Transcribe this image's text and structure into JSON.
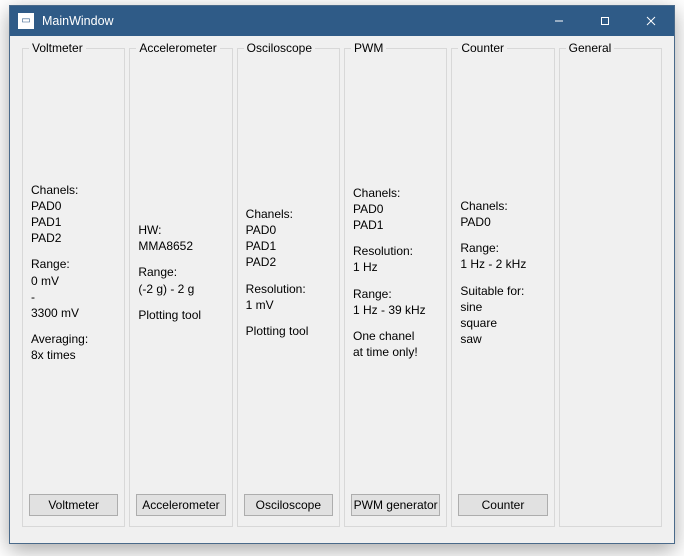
{
  "window": {
    "title": "MainWindow"
  },
  "columns": [
    {
      "title": "Voltmeter",
      "button": "Voltmeter",
      "paragraphs": [
        "Chanels:\nPAD0\nPAD1\nPAD2",
        "Range:\n0 mV\n-\n3300 mV",
        "Averaging:\n8x times"
      ]
    },
    {
      "title": "Accelerometer",
      "button": "Accelerometer",
      "paragraphs": [
        "HW:\nMMA8652",
        "Range:\n(-2 g) - 2 g",
        "Plotting tool"
      ]
    },
    {
      "title": "Osciloscope",
      "button": "Osciloscope",
      "paragraphs": [
        "Chanels:\nPAD0\nPAD1\nPAD2",
        "Resolution:\n1 mV",
        "Plotting tool"
      ]
    },
    {
      "title": "PWM",
      "button": "PWM generator",
      "paragraphs": [
        "Chanels:\nPAD0\nPAD1",
        "Resolution:\n1 Hz",
        "Range:\n1 Hz - 39 kHz",
        "One chanel\nat time only!"
      ]
    },
    {
      "title": "Counter",
      "button": "Counter",
      "paragraphs": [
        "Chanels:\nPAD0",
        "Range:\n1 Hz - 2 kHz",
        "Suitable for:\nsine\nsquare\nsaw"
      ]
    },
    {
      "title": "General",
      "button": null,
      "paragraphs": []
    }
  ]
}
